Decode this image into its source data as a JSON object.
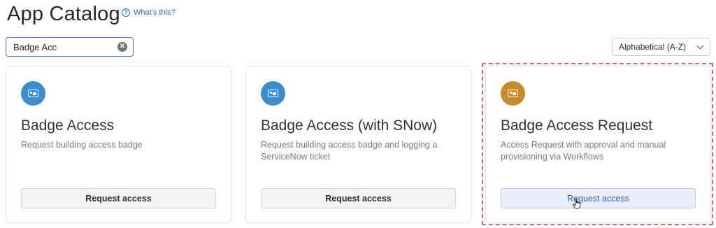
{
  "header": {
    "title": "App Catalog",
    "help_link": "What's this?"
  },
  "search": {
    "value": "Badge Acc",
    "placeholder": ""
  },
  "sort": {
    "selected": "Alphabetical (A-Z)"
  },
  "cards": [
    {
      "name": "Badge Access",
      "description": "Request building access badge",
      "button_label": "Request access",
      "icon": "badge-icon",
      "icon_color": "#3a8dce"
    },
    {
      "name": "Badge Access (with SNow)",
      "description": "Request building access badge and logging a ServiceNow ticket",
      "button_label": "Request access",
      "icon": "badge-icon",
      "icon_color": "#3a8dce"
    },
    {
      "name": "Badge Access Request",
      "description": "Access Request with approval and manual provisioning via Workflows",
      "button_label": "Request access",
      "icon": "badge-icon",
      "icon_color": "#c98a2d"
    }
  ],
  "colors": {
    "accent": "#2b63c9",
    "highlight": "#d06a6a"
  }
}
